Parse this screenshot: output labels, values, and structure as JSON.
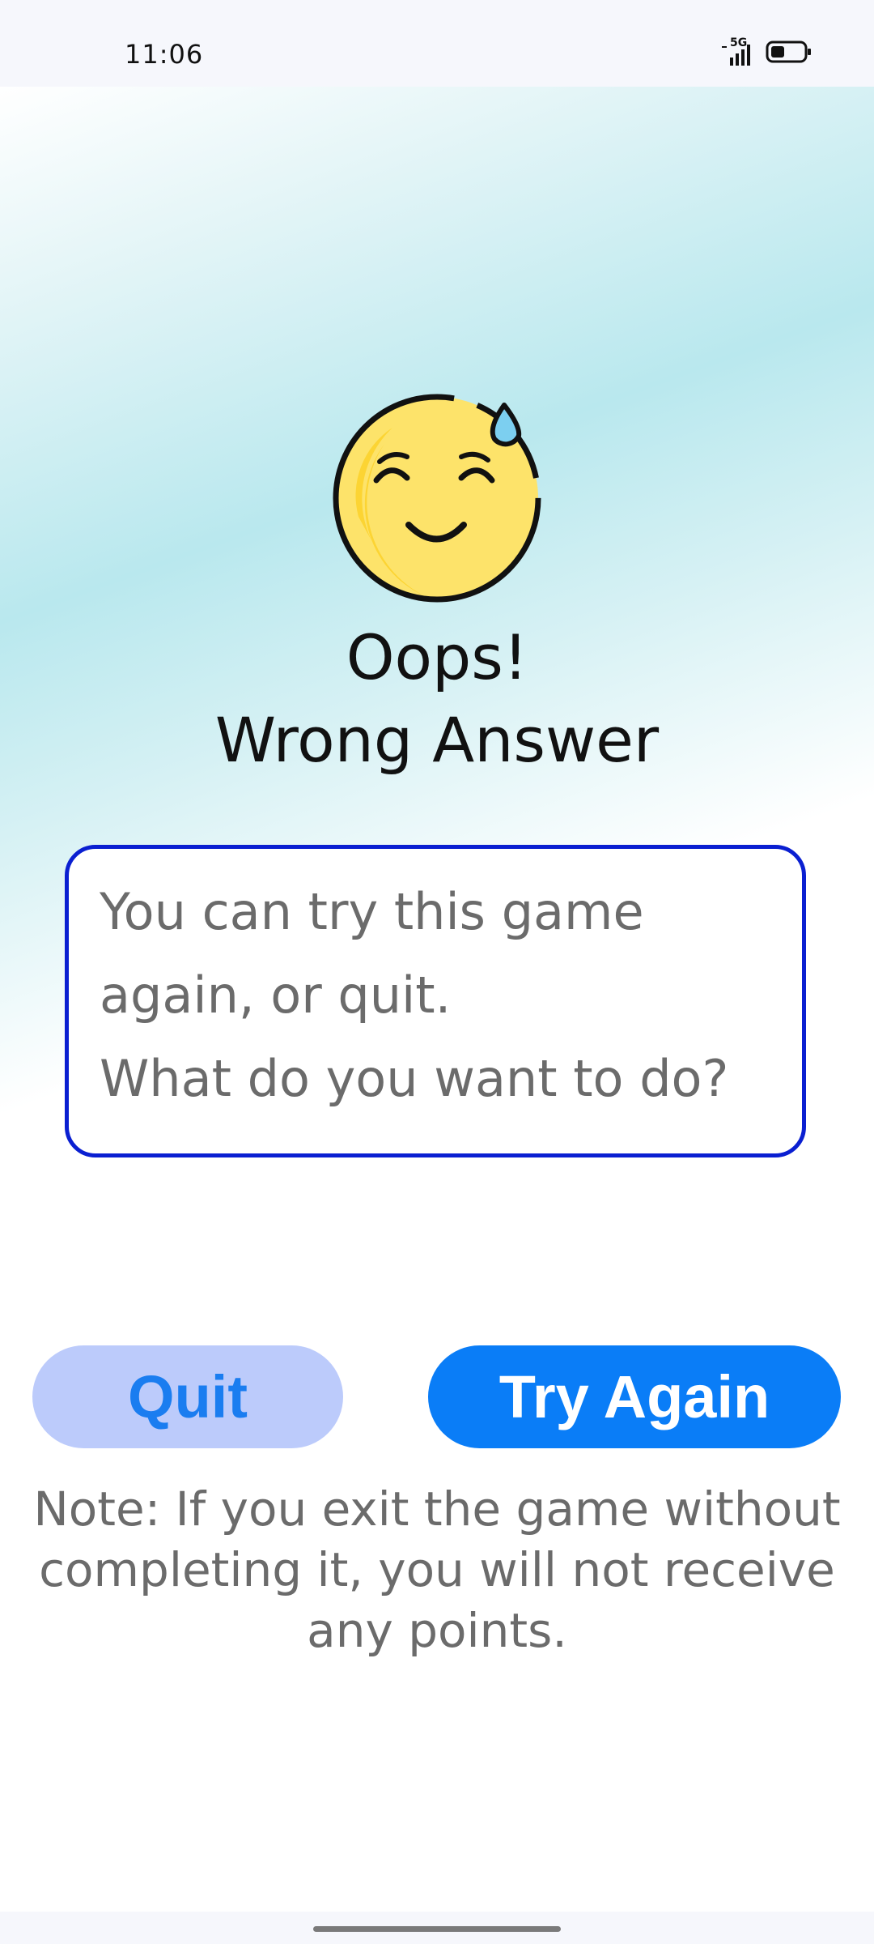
{
  "status_bar": {
    "time": "11:06",
    "network": "5G",
    "icons": [
      "signal-icon",
      "battery-icon"
    ]
  },
  "result": {
    "icon": "sweat-smile-emoji-icon",
    "title_line1": "Oops!",
    "title_line2": "Wrong Answer"
  },
  "message": {
    "line1": "You can try this game",
    "line2": "again, or quit.",
    "line3": "What do you want to do?"
  },
  "actions": {
    "quit_label": "Quit",
    "try_again_label": "Try Again"
  },
  "note": "Note: If you exit the game without completing it, you will not receive any points.",
  "colors": {
    "accent": "#0a7df7",
    "quit_bg": "#bccbfb",
    "box_border": "#0a1fd1",
    "text_gray": "#6b6b6b"
  }
}
